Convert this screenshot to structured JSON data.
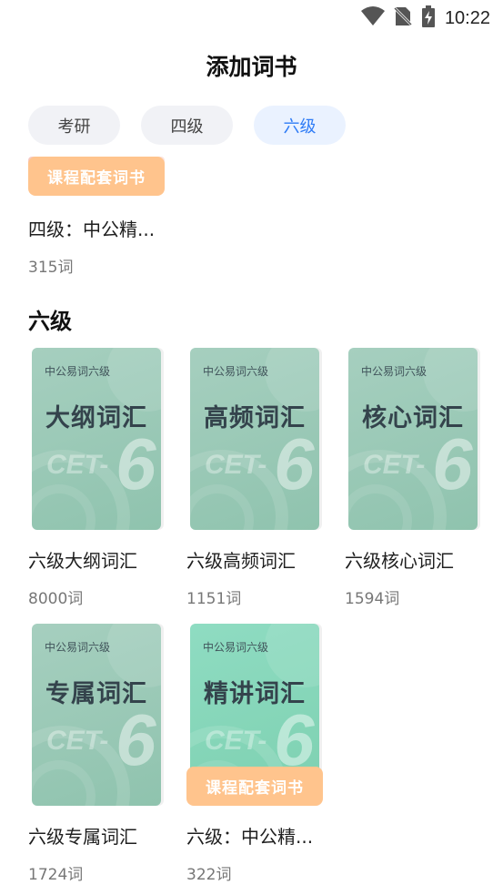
{
  "status_bar": {
    "time": "10:22",
    "icons": [
      "wifi-icon",
      "no-sim-icon",
      "battery-charging-icon"
    ]
  },
  "header": {
    "title": "添加词书"
  },
  "tabs": [
    {
      "label": "考研",
      "active": false
    },
    {
      "label": "四级",
      "active": false
    },
    {
      "label": "六级",
      "active": true
    }
  ],
  "previous_section": {
    "book": {
      "badge": "课程配套词书",
      "name": "四级：中公精...",
      "count": "315词"
    }
  },
  "section": {
    "title": "六级",
    "books": [
      {
        "cover_small": "中公易词六级",
        "cover_title": "大纲词汇",
        "cover_cet": "CET-",
        "cover_six": "6",
        "name": "六级大纲词汇",
        "count": "8000词"
      },
      {
        "cover_small": "中公易词六级",
        "cover_title": "高频词汇",
        "cover_cet": "CET-",
        "cover_six": "6",
        "name": "六级高频词汇",
        "count": "1151词"
      },
      {
        "cover_small": "中公易词六级",
        "cover_title": "核心词汇",
        "cover_cet": "CET-",
        "cover_six": "6",
        "name": "六级核心词汇",
        "count": "1594词"
      },
      {
        "cover_small": "中公易词六级",
        "cover_title": "专属词汇",
        "cover_cet": "CET-",
        "cover_six": "6",
        "name": "六级专属词汇",
        "count": "1724词"
      },
      {
        "cover_small": "中公易词六级",
        "cover_title": "精讲词汇",
        "cover_cet": "CET-",
        "cover_six": "6",
        "name": "六级：中公精...",
        "count": "322词",
        "badge": "课程配套词书"
      }
    ]
  },
  "colors": {
    "accent": "#2f7cf6",
    "badge": "#ffc48d",
    "cover": "#9ccab7"
  }
}
